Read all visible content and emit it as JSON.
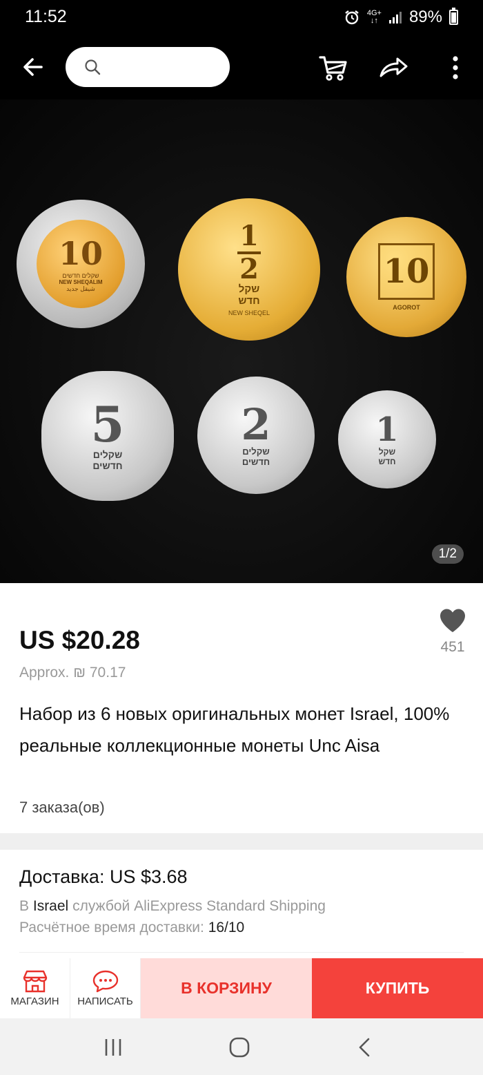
{
  "status_bar": {
    "time": "11:52",
    "network_top": "4G+",
    "network_bottom": "↓↑",
    "battery": "89%"
  },
  "search": {
    "placeholder": ""
  },
  "gallery": {
    "counter": "1/2"
  },
  "coins": [
    {
      "value": "10",
      "line1": "שקלים חדשים",
      "line2": "NEW SHEQALIM",
      "line3": "شيقل جديد"
    },
    {
      "value_top": "1",
      "value_bottom": "2",
      "line1": "שקל",
      "line2": "חדש",
      "line3": "NEW SHEQEL"
    },
    {
      "value": "10",
      "line1": "AGOROT"
    },
    {
      "value": "5",
      "line1": "שקלים",
      "line2": "חדשים"
    },
    {
      "value": "2",
      "line1": "שקלים",
      "line2": "חדשים"
    },
    {
      "value": "1",
      "line1": "שקל",
      "line2": "חדש"
    }
  ],
  "product": {
    "price": "US $20.28",
    "approx": "Approx. ₪ 70.17",
    "wishlist_count": "451",
    "title": "Набор из 6 новых оригинальных монет Israel, 100% реальные коллекционные монеты Unc Aisa",
    "orders": "7 заказа(ов)"
  },
  "delivery": {
    "label": "Доставка: US $3.68",
    "to_prefix": "В",
    "to_country": "Israel",
    "service": "службой AliExpress Standard Shipping",
    "eta_label": "Расчётное время доставки:",
    "eta_value": "16/10"
  },
  "actions": {
    "store_label": "МАГАЗИН",
    "message_label": "НАПИСАТЬ",
    "cart_label": "В КОРЗИНУ",
    "buy_label": "КУПИТЬ"
  },
  "colors": {
    "accent": "#f4423c",
    "cart_bg": "#ffdbd9",
    "cart_text": "#e8312b"
  }
}
